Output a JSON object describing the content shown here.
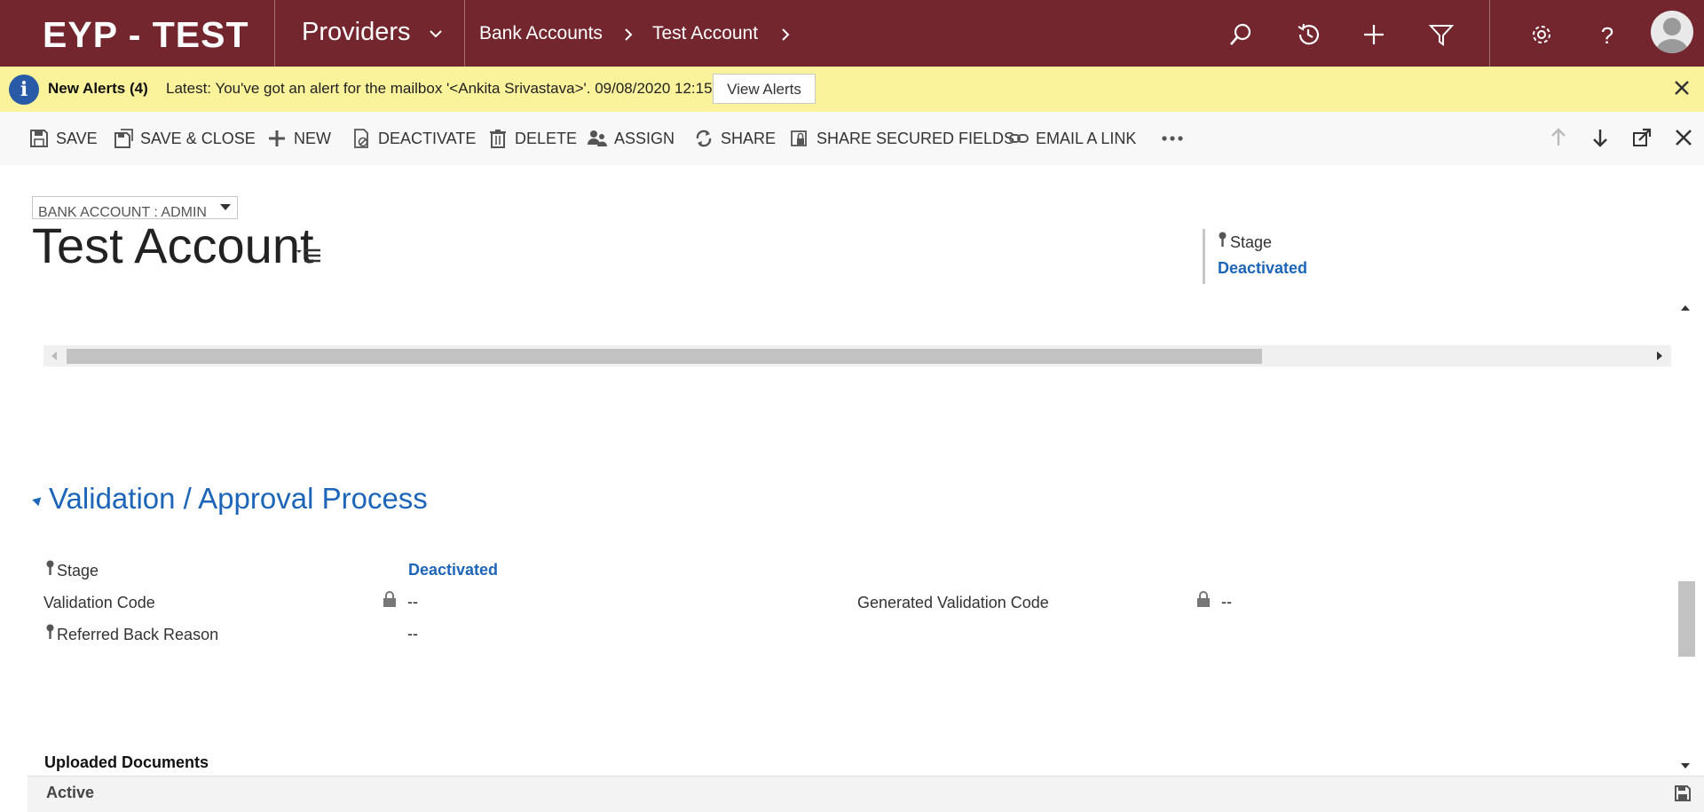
{
  "app": {
    "title": "EYP - TEST",
    "area": "Providers"
  },
  "breadcrumb": [
    "Bank Accounts",
    "Test Account"
  ],
  "topbar_icons": [
    "search-icon",
    "history-icon",
    "plus-icon",
    "filter-icon",
    "settings-icon",
    "help-icon",
    "user-avatar"
  ],
  "alert": {
    "title": "New Alerts (4)",
    "message": "Latest: You've got an alert for the mailbox '<Ankita Srivastava>'. 09/08/2020 12:15",
    "button": "View Alerts",
    "background": "#fbf39c"
  },
  "commands": {
    "save": "SAVE",
    "save_close": "SAVE & CLOSE",
    "new": "NEW",
    "deactivate": "DEACTIVATE",
    "delete": "DELETE",
    "assign": "ASSIGN",
    "share": "SHARE",
    "share_secured": "SHARE SECURED FIELDS",
    "email_link": "EMAIL A LINK"
  },
  "record": {
    "form_selector": "BANK ACCOUNT : ADMIN",
    "title": "Test Account",
    "header_stage_label": "Stage",
    "header_stage_value": "Deactivated"
  },
  "section": {
    "title": "Validation / Approval Process",
    "fields": {
      "stage_label": "Stage",
      "stage_value": "Deactivated",
      "validation_code_label": "Validation Code",
      "validation_code_value": "--",
      "generated_code_label": "Generated Validation Code",
      "generated_code_value": "--",
      "referred_back_label": "Referred Back Reason",
      "referred_back_value": "--"
    },
    "subgrid_title": "Uploaded Documents"
  },
  "footer": {
    "status": "Active"
  },
  "colors": {
    "brand": "#74262f",
    "link": "#1d65b8"
  }
}
